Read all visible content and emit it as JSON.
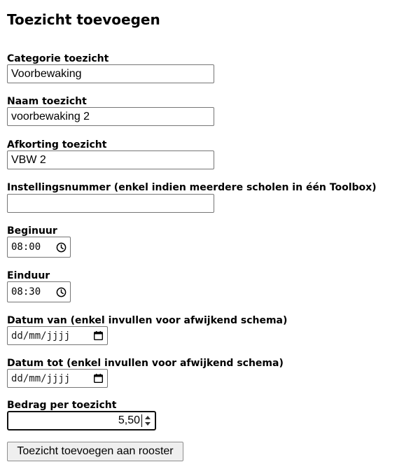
{
  "page": {
    "title": "Toezicht toevoegen"
  },
  "form": {
    "categorie": {
      "label": "Categorie toezicht",
      "value": "Voorbewaking"
    },
    "naam": {
      "label": "Naam toezicht",
      "value": "voorbewaking 2"
    },
    "afkorting": {
      "label": "Afkorting toezicht",
      "value": "VBW 2"
    },
    "instellingsnummer": {
      "label": "Instellingsnummer (enkel indien meerdere scholen in één Toolbox)",
      "value": ""
    },
    "beginuur": {
      "label": "Beginuur",
      "value": "08:00",
      "icon": "clock-icon"
    },
    "einduur": {
      "label": "Einduur",
      "value": "08:30",
      "icon": "clock-icon"
    },
    "datum_van": {
      "label": "Datum van (enkel invullen voor afwijkend schema)",
      "placeholder": "dd/mm/jjjj",
      "icon": "calendar-icon"
    },
    "datum_tot": {
      "label": "Datum tot (enkel invullen voor afwijkend schema)",
      "placeholder": "dd/mm/jjjj",
      "icon": "calendar-icon"
    },
    "bedrag": {
      "label": "Bedrag per toezicht",
      "value": "5,50",
      "icon": "spinner-arrows-icon"
    },
    "submit_label": "Toezicht toevoegen aan rooster"
  },
  "colors": {
    "field_border": "#767676",
    "focused_border": "#101010",
    "button_bg": "#efefef",
    "button_border": "#8f8f8f"
  }
}
